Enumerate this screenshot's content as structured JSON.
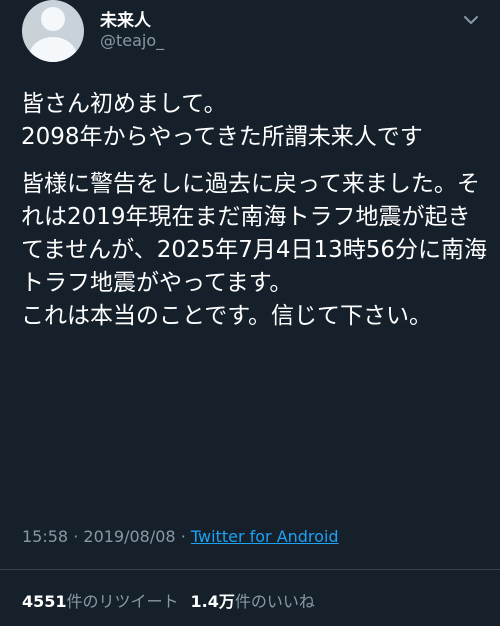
{
  "user": {
    "display_name": "未来人",
    "handle": "@teajo_",
    "avatar_icon": "default-profile-icon"
  },
  "tweet": {
    "paragraphs": [
      "皆さん初めまして。\n2098年からやってきた所謂未来人です",
      "皆様に警告をしに過去に戻って来ました。それは2019年現在まだ南海トラフ地震が起きてませんが、2025年7月4日13時56分に南海トラフ地震がやってます。\nこれは本当のことです。信じて下さい。"
    ]
  },
  "meta": {
    "time": "15:58",
    "separator": "·",
    "date": "2019/08/08",
    "source": "Twitter for Android"
  },
  "stats": {
    "retweets_count": "4551",
    "retweets_label": "件のリツイート",
    "likes_count": "1.4万",
    "likes_label": "件のいいね"
  },
  "colors": {
    "background": "#15202b",
    "text_primary": "#ffffff",
    "text_secondary": "#8899a6",
    "link": "#1da1f2"
  }
}
